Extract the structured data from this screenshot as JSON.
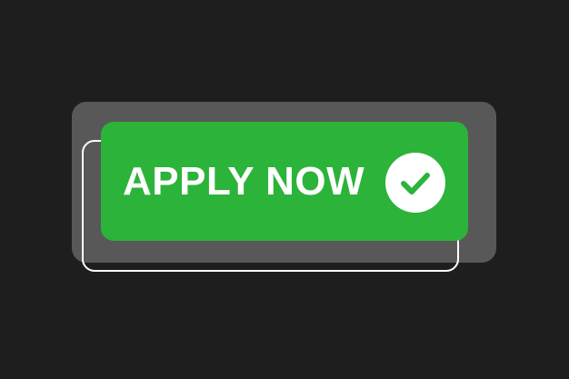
{
  "colors": {
    "background": "#1e1e1e",
    "back_card": "#585858",
    "button": "#2cb33a",
    "text": "#ffffff",
    "outline": "#ffffff",
    "check_mark": "#2cb33a"
  },
  "button": {
    "label": "APPLY NOW",
    "icon": "check-circle-icon"
  }
}
